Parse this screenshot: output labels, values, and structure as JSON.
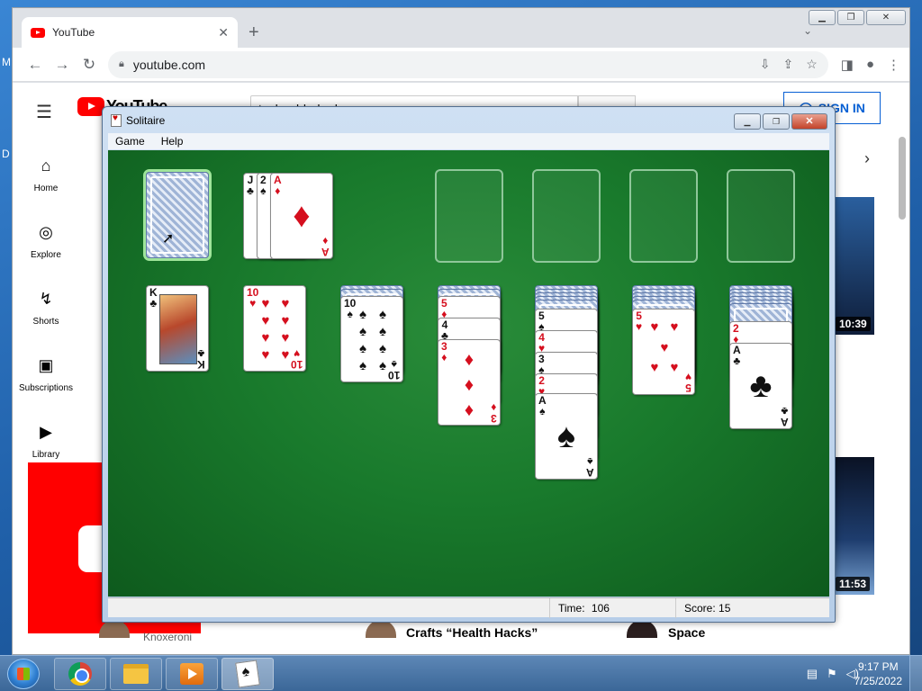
{
  "browser": {
    "tab_title": "YouTube",
    "url": "youtube.com",
    "new_tab_label": "+",
    "close_label": "✕"
  },
  "youtube": {
    "logo_text": "YouTube",
    "search_value": "technoblade dog",
    "sign_in_label": "SIGN IN",
    "sidebar": [
      {
        "icon": "home-icon",
        "glyph": "⌂",
        "label": "Home"
      },
      {
        "icon": "explore-icon",
        "glyph": "◎",
        "label": "Explore"
      },
      {
        "icon": "shorts-icon",
        "glyph": "↯",
        "label": "Shorts"
      },
      {
        "icon": "subscriptions-icon",
        "glyph": "▣",
        "label": "Subscriptions"
      },
      {
        "icon": "library-icon",
        "glyph": "▶",
        "label": "Library"
      }
    ],
    "durations": [
      "10:39",
      "11:53"
    ],
    "video_meta": {
      "channel": "Knoxeroni",
      "title_2": "Crafts “Health Hacks”",
      "title_3": "Space"
    }
  },
  "solitaire": {
    "window_title": "Solitaire",
    "menu": [
      "Game",
      "Help"
    ],
    "status": {
      "time_label": "Time:",
      "time_value": "106",
      "score_label": "Score:",
      "score_value": "15"
    }
  },
  "taskbar": {
    "time": "9:17 PM",
    "date": "7/25/2022"
  },
  "colors": {
    "felt": "#197a2c",
    "yt_red": "#ff0000",
    "card_red": "#d50f1e"
  }
}
